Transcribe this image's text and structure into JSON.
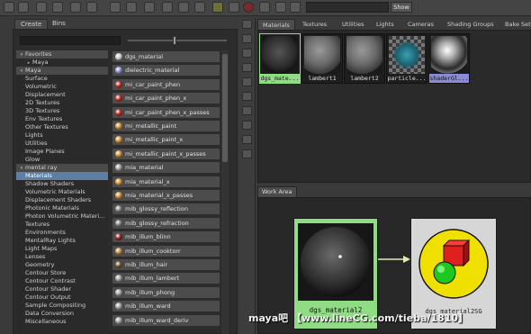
{
  "toolbar": {
    "show_label": "Show"
  },
  "left_tabs": [
    "Create",
    "Bins"
  ],
  "tree": [
    {
      "label": "Favorites",
      "indent": 0,
      "expander": "▾",
      "header": true
    },
    {
      "label": "Maya",
      "indent": 1,
      "expander": "▸"
    },
    {
      "label": "Maya",
      "indent": 0,
      "expander": "▾",
      "header": true
    },
    {
      "label": "Surface",
      "indent": 1
    },
    {
      "label": "Volumetric",
      "indent": 1
    },
    {
      "label": "Displacement",
      "indent": 1
    },
    {
      "label": "2D Textures",
      "indent": 1
    },
    {
      "label": "3D Textures",
      "indent": 1
    },
    {
      "label": "Env Textures",
      "indent": 1
    },
    {
      "label": "Other Textures",
      "indent": 1
    },
    {
      "label": "Lights",
      "indent": 1
    },
    {
      "label": "Utilities",
      "indent": 1
    },
    {
      "label": "Image Planes",
      "indent": 1
    },
    {
      "label": "Glow",
      "indent": 1
    },
    {
      "label": "mental ray",
      "indent": 0,
      "expander": "▾",
      "header": true
    },
    {
      "label": "Materials",
      "indent": 1,
      "selected": true
    },
    {
      "label": "Shadow Shaders",
      "indent": 1
    },
    {
      "label": "Volumetric Materials",
      "indent": 1
    },
    {
      "label": "Displacement Shaders",
      "indent": 1
    },
    {
      "label": "Photonic Materials",
      "indent": 1
    },
    {
      "label": "Photon Volumetric Materi...",
      "indent": 1
    },
    {
      "label": "Textures",
      "indent": 1
    },
    {
      "label": "Environments",
      "indent": 1
    },
    {
      "label": "MentalRay Lights",
      "indent": 1
    },
    {
      "label": "Light Maps",
      "indent": 1
    },
    {
      "label": "Lenses",
      "indent": 1
    },
    {
      "label": "Geometry",
      "indent": 1
    },
    {
      "label": "Contour Store",
      "indent": 1
    },
    {
      "label": "Contour Contrast",
      "indent": 1
    },
    {
      "label": "Contour Shader",
      "indent": 1
    },
    {
      "label": "Contour Output",
      "indent": 1
    },
    {
      "label": "Sample Compositing",
      "indent": 1
    },
    {
      "label": "Data Conversion",
      "indent": 1
    },
    {
      "label": "Miscellaneous",
      "indent": 1
    }
  ],
  "nodes": [
    {
      "label": "dgs_material",
      "color": "#c9c9c9"
    },
    {
      "label": "dielectric_material",
      "color": "#8a8ad0"
    },
    {
      "label": "mi_car_paint_phen",
      "color": "#b3241e"
    },
    {
      "label": "mi_car_paint_phen_x",
      "color": "#b3241e"
    },
    {
      "label": "mi_car_paint_phen_x_passes",
      "color": "#b3241e"
    },
    {
      "label": "mi_metallic_paint",
      "color": "#c98a2c"
    },
    {
      "label": "mi_metallic_paint_x",
      "color": "#c98a2c"
    },
    {
      "label": "mi_metallic_paint_x_passes",
      "color": "#c98a2c"
    },
    {
      "label": "mia_material",
      "color": "#9a9a9a"
    },
    {
      "label": "mia_material_x",
      "color": "#c98a2c"
    },
    {
      "label": "mia_material_x_passes",
      "color": "#c98a2c"
    },
    {
      "label": "mib_glossy_reflection",
      "color": "#7a7a7a"
    },
    {
      "label": "mib_glossy_refraction",
      "color": "#7a7a7a"
    },
    {
      "label": "mib_illum_blinn",
      "color": "#8a1e1e"
    },
    {
      "label": "mib_illum_cooktorr",
      "color": "#b8863a"
    },
    {
      "label": "mib_illum_hair",
      "color": "#6a4a2a"
    },
    {
      "label": "mib_illum_lambert",
      "color": "#9a9a9a"
    },
    {
      "label": "mib_illum_phong",
      "color": "#9a9a9a"
    },
    {
      "label": "mib_illum_ward",
      "color": "#9a9a9a"
    },
    {
      "label": "mib_illum_ward_deriv",
      "color": "#9a9a9a"
    }
  ],
  "material_tabs": [
    "Materials",
    "Textures",
    "Utilities",
    "Lights",
    "Cameras",
    "Shading Groups",
    "Bake Sets"
  ],
  "swatches": [
    {
      "label": "dgs_mate...",
      "kind": "dark",
      "selected": true
    },
    {
      "label": "lambert1",
      "kind": "gray"
    },
    {
      "label": "lambert2",
      "kind": "gray"
    },
    {
      "label": "particle...",
      "kind": "checker"
    },
    {
      "label": "shaderGl...",
      "kind": "chrome",
      "highlight": true
    }
  ],
  "work_area": {
    "tab_label": "Work Area",
    "node1_label": "dgs_material2",
    "node2_label": "dgs_material2SG"
  },
  "watermark": "maya吧 【www.lineCG.com/tieba/1810】",
  "colors": {
    "selected_node": "#8fdc84",
    "selection_blue": "#5d7fa3"
  }
}
